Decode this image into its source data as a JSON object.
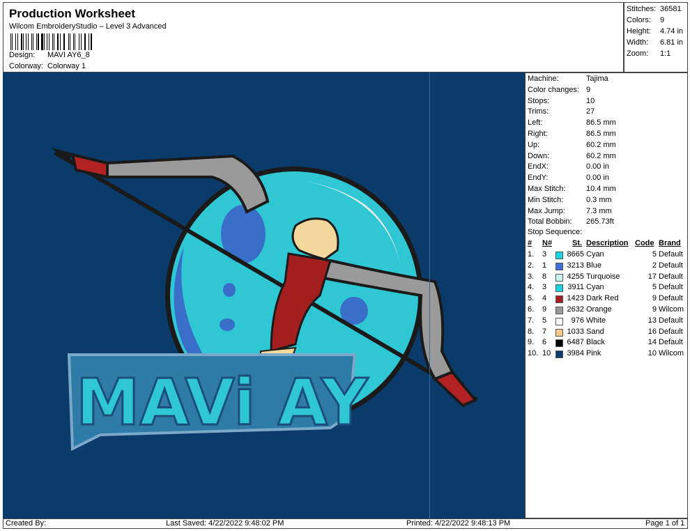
{
  "header": {
    "title": "Production Worksheet",
    "subtitle": "Wilcom EmbroideryStudio – Level 3 Advanced",
    "design_label": "Design:",
    "design_value": "MAVI AY6_8",
    "colorway_label": "Colorway:",
    "colorway_value": "Colorway 1"
  },
  "stats": [
    {
      "label": "Stitches:",
      "value": "36581"
    },
    {
      "label": "Colors:",
      "value": "9"
    },
    {
      "label": "Height:",
      "value": "4.74 in"
    },
    {
      "label": "Width:",
      "value": "6.81 in"
    },
    {
      "label": "Zoom:",
      "value": "1:1"
    }
  ],
  "machine_info": [
    {
      "label": "Machine:",
      "value": "Tajima"
    },
    {
      "label": "Color changes:",
      "value": "9"
    },
    {
      "label": "Stops:",
      "value": "10"
    },
    {
      "label": "Trims:",
      "value": "27"
    },
    {
      "label": "Left:",
      "value": "86.5 mm"
    },
    {
      "label": "Right:",
      "value": "86.5 mm"
    },
    {
      "label": "Up:",
      "value": "60.2 mm"
    },
    {
      "label": "Down:",
      "value": "60.2 mm"
    },
    {
      "label": "EndX:",
      "value": "0.00 in"
    },
    {
      "label": "EndY:",
      "value": "0.00 in"
    },
    {
      "label": "Max Stitch:",
      "value": "10.4 mm"
    },
    {
      "label": "Min Stitch:",
      "value": "0.3 mm"
    },
    {
      "label": "Max Jump:",
      "value": "7.3 mm"
    },
    {
      "label": "Total Bobbin:",
      "value": "265.73ft"
    }
  ],
  "stop_sequence": {
    "title": "Stop Sequence:",
    "headers": {
      "num": "#",
      "n": "N#",
      "st": "St.",
      "desc": "Description",
      "code": "Code",
      "brand": "Brand"
    },
    "rows": [
      {
        "num": "1.",
        "n": "3",
        "color": "#19d3e0",
        "st": "8665",
        "desc": "Cyan",
        "code": "5",
        "brand": "Default"
      },
      {
        "num": "2.",
        "n": "1",
        "color": "#3f6fd8",
        "st": "3213",
        "desc": "Blue",
        "code": "2",
        "brand": "Default"
      },
      {
        "num": "3.",
        "n": "8",
        "color": "#c9f3f1",
        "st": "4255",
        "desc": "Turquoise",
        "code": "17",
        "brand": "Default"
      },
      {
        "num": "4.",
        "n": "3",
        "color": "#19d3e0",
        "st": "3911",
        "desc": "Cyan",
        "code": "5",
        "brand": "Default"
      },
      {
        "num": "5.",
        "n": "4",
        "color": "#a31e1e",
        "st": "1423",
        "desc": "Dark Red",
        "code": "9",
        "brand": "Default"
      },
      {
        "num": "6.",
        "n": "9",
        "color": "#9a9a9a",
        "st": "2632",
        "desc": "Orange",
        "code": "9",
        "brand": "Wilcom"
      },
      {
        "num": "7.",
        "n": "5",
        "color": "#ffffff",
        "st": "976",
        "desc": "White",
        "code": "13",
        "brand": "Default"
      },
      {
        "num": "8.",
        "n": "7",
        "color": "#f4c98a",
        "st": "1033",
        "desc": "Sand",
        "code": "16",
        "brand": "Default"
      },
      {
        "num": "9.",
        "n": "6",
        "color": "#000000",
        "st": "6487",
        "desc": "Black",
        "code": "14",
        "brand": "Default"
      },
      {
        "num": "10.",
        "n": "10",
        "color": "#0b3b6b",
        "st": "3984",
        "desc": "Pink",
        "code": "10",
        "brand": "Wilcom"
      }
    ]
  },
  "footer": {
    "created_by": "Created By:",
    "last_saved": "Last Saved: 4/22/2022 9:48:02 PM",
    "printed": "Printed: 4/22/2022 9:48:13 PM",
    "page": "Page 1 of 1"
  }
}
